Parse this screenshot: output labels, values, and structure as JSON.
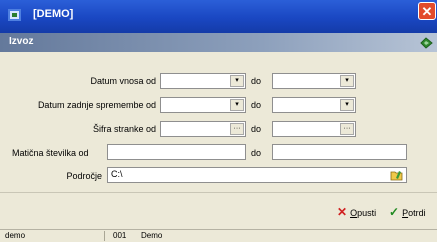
{
  "window": {
    "title": "[DEMO]"
  },
  "section": {
    "title": "Izvoz"
  },
  "form": {
    "date_entry_label": "Datum vnosa od",
    "date_change_label": "Datum zadnje spremembe od",
    "client_code_label": "Šifra stranke od",
    "reg_number_label": "Matična številka od",
    "area_label": "Področje",
    "to_label": "do",
    "area_value": "C:\\",
    "dropdown_glyph": "▾",
    "lookup_glyph": "···"
  },
  "actions": {
    "cancel_label": "Opusti",
    "confirm_label": "Potrdi",
    "cancel_mnemonic": "O",
    "confirm_mnemonic": "P"
  },
  "status": {
    "user": "demo",
    "code": "001",
    "company": "Demo"
  },
  "icons": {
    "app": "app-icon",
    "close": "close-icon",
    "section": "section-icon",
    "cancel": "x-icon",
    "confirm": "check-icon",
    "browse": "folder-browse-icon"
  },
  "colors": {
    "titlebar": "#1a47c2",
    "cancel": "#d02020",
    "confirm": "#1f8a1f"
  }
}
